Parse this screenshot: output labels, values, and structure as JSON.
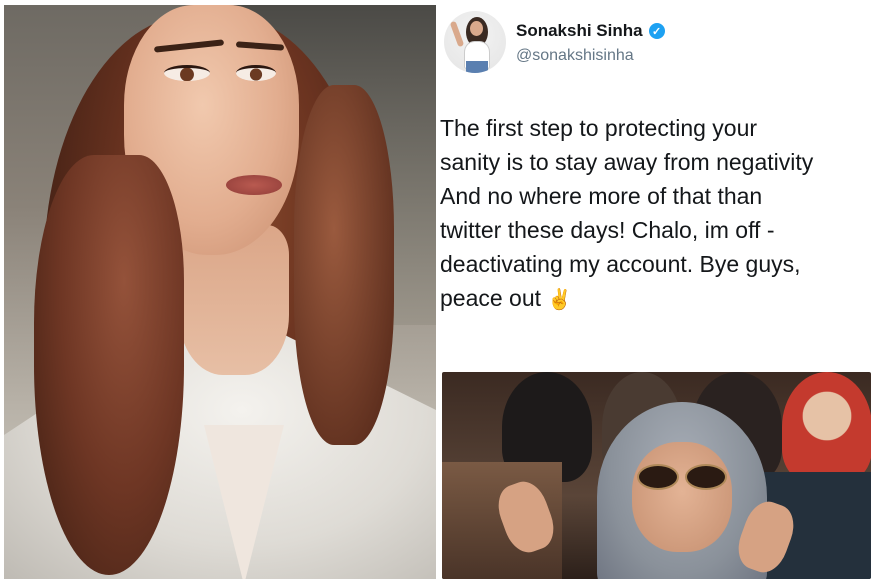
{
  "tweet": {
    "display_name": "Sonakshi Sinha",
    "handle": "@sonakshisinha",
    "text": "The first step to protecting your\nsanity is to stay away from negativity\nAnd no where more of that than\ntwitter these days! Chalo, im off -\ndeactivating my account. Bye guys,\npeace out",
    "verified_glyph": "✓",
    "peace_glyph": "✌",
    "icons": [
      "verified-icon",
      "peace-icon"
    ]
  },
  "colors": {
    "verified": "#1da1f2",
    "name": "#14171a",
    "handle": "#657786"
  }
}
